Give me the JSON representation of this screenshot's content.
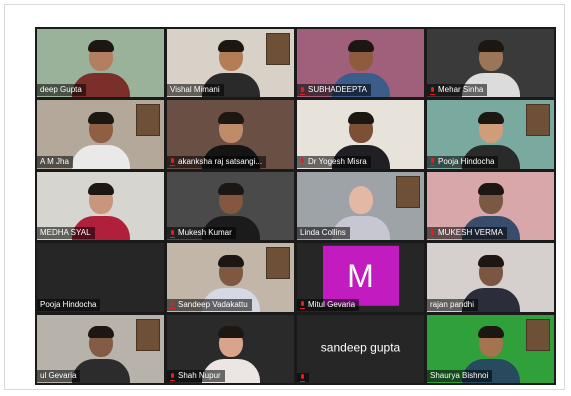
{
  "colors": {
    "frame_border": "#d9d9d9",
    "gallery_bg": "#1a1a1a",
    "active_speaker": "#9acd32",
    "mic_muted": "#e02020",
    "avatar_tile": "#c21bc0"
  },
  "tiles": [
    {
      "name": "deep Gupta",
      "muted": false,
      "bg": "#9bb29a",
      "skin": "#b37f5f",
      "shirt": "#7a2f2a",
      "active": true,
      "avatar": "",
      "hair": true
    },
    {
      "name": "Vishal Mimani",
      "muted": false,
      "bg": "#d7d1c7",
      "skin": "#b57d56",
      "shirt": "#2a2a2a",
      "active": false,
      "avatar": "",
      "hair": true
    },
    {
      "name": "SUBHADEEPTA",
      "muted": true,
      "bg": "#a0607c",
      "skin": "#8e5b3e",
      "shirt": "#3c5c8a",
      "active": false,
      "avatar": "",
      "hair": true
    },
    {
      "name": "Mehar Sinha",
      "muted": true,
      "bg": "#3a3a3a",
      "skin": "#9c7458",
      "shirt": "#dcdcdc",
      "active": false,
      "avatar": "",
      "hair": true
    },
    {
      "name": "A M Jha",
      "muted": false,
      "bg": "#b4a89a",
      "skin": "#8f5e43",
      "shirt": "#e9e9ea",
      "active": false,
      "avatar": "",
      "hair": true
    },
    {
      "name": "akanksha raj satsangi...",
      "muted": true,
      "bg": "#6a4f45",
      "skin": "#c08b69",
      "shirt": "#141414",
      "active": false,
      "avatar": "",
      "hair": true
    },
    {
      "name": "Dr Yogesh Misra",
      "muted": true,
      "bg": "#e8e3da",
      "skin": "#7c5037",
      "shirt": "#1f1f24",
      "active": false,
      "avatar": "",
      "hair": true
    },
    {
      "name": "Pooja Hindocha",
      "muted": true,
      "bg": "#7aa9a0",
      "skin": "#d09d7b",
      "shirt": "#2a2a2a",
      "active": false,
      "avatar": "",
      "hair": true
    },
    {
      "name": "MEDHA SYAL",
      "muted": false,
      "bg": "#d6d5cf",
      "skin": "#c8967a",
      "shirt": "#b0203a",
      "active": false,
      "avatar": "",
      "hair": true
    },
    {
      "name": "Mukesh Kumar",
      "muted": true,
      "bg": "#4a4a4a",
      "skin": "#835740",
      "shirt": "#1b1b1b",
      "active": false,
      "avatar": "",
      "hair": true
    },
    {
      "name": "Linda Collins",
      "muted": false,
      "bg": "#9ea3a8",
      "skin": "#e3b9a6",
      "shirt": "#c7c7d2",
      "active": false,
      "avatar": "",
      "hair": false
    },
    {
      "name": "MUKESH VERMA",
      "muted": true,
      "bg": "#d7a7a9",
      "skin": "#7b5844",
      "shirt": "#3a4c6c",
      "active": false,
      "avatar": "",
      "hair": true
    },
    {
      "name": "Pooja Hindocha",
      "muted": false,
      "bg": "#262626",
      "skin": "",
      "shirt": "",
      "active": false,
      "avatar": "",
      "hair": false
    },
    {
      "name": "Sandeep Vadakattu",
      "muted": true,
      "bg": "#c1b6a8",
      "skin": "#7e5841",
      "shirt": "#d6d9e4",
      "active": false,
      "avatar": "",
      "hair": true
    },
    {
      "name": "Mitul Gevaria",
      "muted": true,
      "bg": "#262626",
      "skin": "",
      "shirt": "",
      "active": false,
      "avatar": "M",
      "hair": false
    },
    {
      "name": "rajan pandhi",
      "muted": false,
      "bg": "#d5d0cd",
      "skin": "#7c5641",
      "shirt": "#2b2e3a",
      "active": false,
      "avatar": "",
      "hair": true
    },
    {
      "name": "ul Gevaria",
      "muted": false,
      "bg": "#b7b3ab",
      "skin": "#835c45",
      "shirt": "#2c2c2c",
      "active": false,
      "avatar": "",
      "hair": true
    },
    {
      "name": "Shah Nupur",
      "muted": true,
      "bg": "#2a2a2a",
      "skin": "#d8a58a",
      "shirt": "#ebe6e3",
      "active": false,
      "avatar": "",
      "hair": true
    },
    {
      "name": "",
      "muted": true,
      "bg": "#262626",
      "skin": "",
      "shirt": "",
      "active": false,
      "avatar": "",
      "hair": false,
      "center_name": "sandeep gupta"
    },
    {
      "name": "Shaurya Bishnoi",
      "muted": false,
      "bg": "#2fa03a",
      "skin": "#a3744f",
      "shirt": "#274a5f",
      "active": false,
      "avatar": "",
      "hair": true
    }
  ]
}
